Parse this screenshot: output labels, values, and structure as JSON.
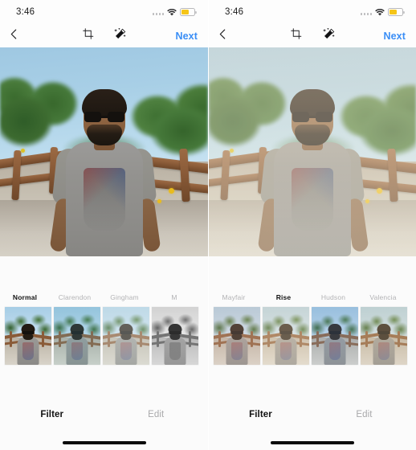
{
  "app": {
    "name": "Photo Filter Editor",
    "accent_color": "#3a8ef6",
    "battery_color": "#f5c518"
  },
  "panels": [
    {
      "id": "left",
      "status": {
        "time": "3:46",
        "signal_icon": "signal-dots-icon",
        "wifi_icon": "wifi-icon",
        "battery_icon": "battery-icon",
        "battery_level": "60"
      },
      "navbar": {
        "back_icon": "chevron-left-icon",
        "crop_icon": "crop-icon",
        "magic_icon": "magic-wand-icon",
        "next_label": "Next"
      },
      "photo": {
        "alt": "Man with sunglasses and beard standing on a wooden bridge, unfiltered",
        "filter_applied": "Normal"
      },
      "filters": [
        {
          "label": "Normal",
          "selected": true,
          "tint": "none"
        },
        {
          "label": "Clarendon",
          "selected": false,
          "tint": "clarendon"
        },
        {
          "label": "Gingham",
          "selected": false,
          "tint": "gingham"
        },
        {
          "label": "M",
          "selected": false,
          "tint": "moon"
        }
      ],
      "tabs": [
        {
          "label": "Filter",
          "active": true
        },
        {
          "label": "Edit",
          "active": false
        }
      ]
    },
    {
      "id": "right",
      "status": {
        "time": "3:46",
        "signal_icon": "signal-dots-icon",
        "wifi_icon": "wifi-icon",
        "battery_icon": "battery-icon",
        "battery_level": "60"
      },
      "navbar": {
        "back_icon": "chevron-left-icon",
        "crop_icon": "crop-icon",
        "magic_icon": "magic-wand-icon",
        "next_label": "Next"
      },
      "photo": {
        "alt": "Man with sunglasses and beard standing on a wooden bridge, warm Rise filter applied",
        "filter_applied": "Rise"
      },
      "filters": [
        {
          "label": "Mayfair",
          "selected": false,
          "tint": "mayfair"
        },
        {
          "label": "Rise",
          "selected": true,
          "tint": "rise"
        },
        {
          "label": "Hudson",
          "selected": false,
          "tint": "hudson"
        },
        {
          "label": "Valencia",
          "selected": false,
          "tint": "valencia"
        }
      ],
      "tabs": [
        {
          "label": "Filter",
          "active": true
        },
        {
          "label": "Edit",
          "active": false
        }
      ]
    }
  ]
}
